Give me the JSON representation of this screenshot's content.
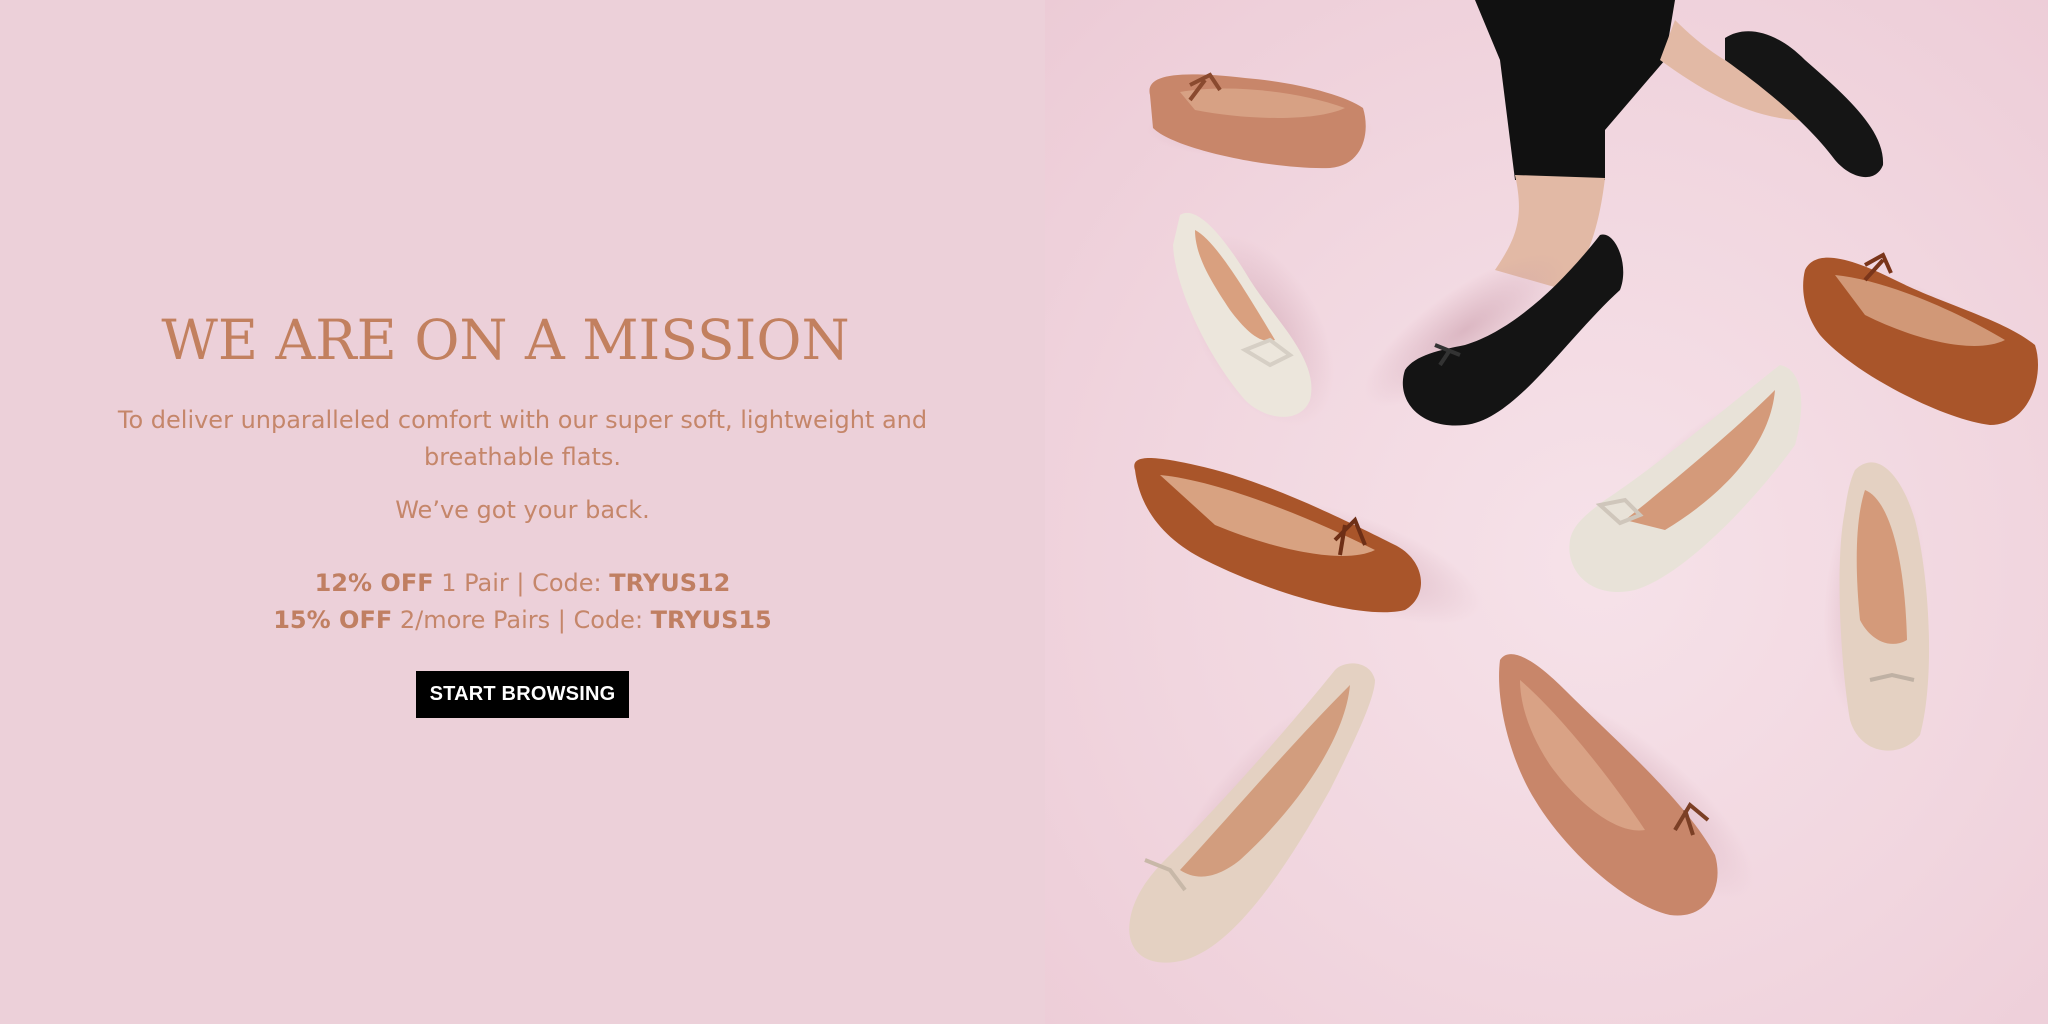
{
  "hero": {
    "headline": "WE ARE ON A MISSION",
    "mission_line1": "To deliver unparalleled comfort with our super soft, lightweight and",
    "mission_line2": "breathable flats.",
    "tagline": "We’ve got your back.",
    "offers": [
      {
        "discount": "12% OFF",
        "detail": " 1 Pair | Code: ",
        "code": "TRYUS12"
      },
      {
        "discount": "15% OFF",
        "detail": " 2/more Pairs | Code: ",
        "code": "TRYUS15"
      }
    ],
    "cta_label": "START BROWSING"
  },
  "colors": {
    "left_background": "#ecd0d9",
    "text_accent": "#c2805f",
    "button_background": "#000000",
    "button_text": "#ffffff"
  },
  "photo": {
    "subject": "ballet-flats-product-photo"
  }
}
